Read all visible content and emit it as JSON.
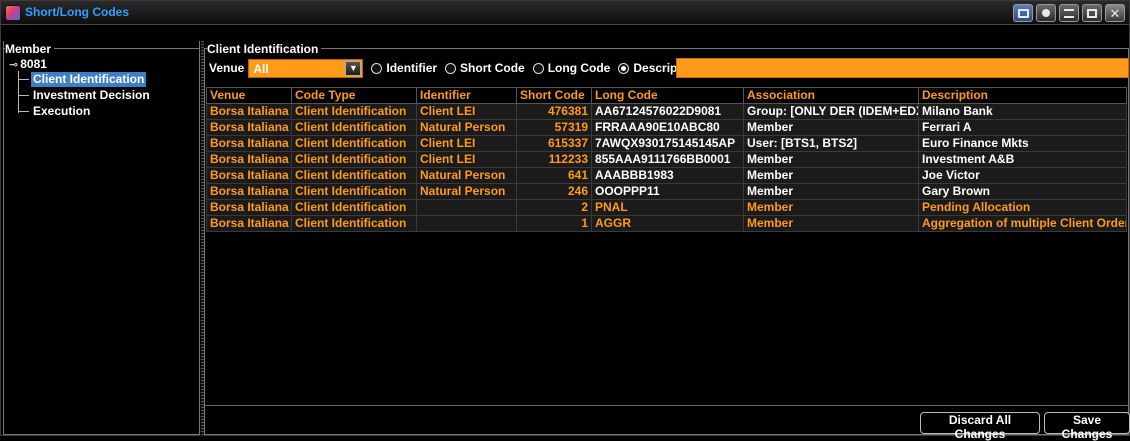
{
  "window": {
    "title": "Short/Long Codes"
  },
  "tree": {
    "legend": "Member",
    "root": "8081",
    "items": [
      {
        "label": "Client Identification",
        "selected": true
      },
      {
        "label": "Investment Decision",
        "selected": false
      },
      {
        "label": "Execution",
        "selected": false
      }
    ]
  },
  "group": {
    "legend": "Client Identification"
  },
  "filter": {
    "venue_label": "Venue",
    "venue_value": "All",
    "radios": [
      {
        "label": "Identifier",
        "checked": false
      },
      {
        "label": "Short Code",
        "checked": false
      },
      {
        "label": "Long Code",
        "checked": false
      },
      {
        "label": "Description",
        "checked": true
      }
    ],
    "search_value": ""
  },
  "table": {
    "columns": [
      "Venue",
      "Code Type",
      "Identifier",
      "Short Code",
      "Long Code",
      "Association",
      "Description"
    ],
    "rows": [
      [
        "Borsa Italiana",
        "Client Identification",
        "Client LEI",
        "476381",
        "AA67124576022D9081",
        "Group: [ONLY DER (IDEM+EDX)]",
        "Milano Bank"
      ],
      [
        "Borsa Italiana",
        "Client Identification",
        "Natural Person",
        "57319",
        "FRRAAA90E10ABC80",
        "Member",
        "Ferrari A"
      ],
      [
        "Borsa Italiana",
        "Client Identification",
        "Client LEI",
        "615337",
        "7AWQX930175145145AP",
        "User: [BTS1, BTS2]",
        "Euro Finance Mkts"
      ],
      [
        "Borsa Italiana",
        "Client Identification",
        "Client LEI",
        "112233",
        "855AAA9111766BB0001",
        "Member",
        "Investment A&B"
      ],
      [
        "Borsa Italiana",
        "Client Identification",
        "Natural Person",
        "641",
        "AAABBB1983",
        "Member",
        "Joe Victor"
      ],
      [
        "Borsa Italiana",
        "Client Identification",
        "Natural Person",
        "246",
        "OOOPPP11",
        "Member",
        "Gary Brown"
      ],
      [
        "Borsa Italiana",
        "Client Identification",
        "",
        "2",
        "PNAL",
        "Member",
        "Pending Allocation"
      ],
      [
        "Borsa Italiana",
        "Client Identification",
        "",
        "1",
        "AGGR",
        "Member",
        "Aggregation of multiple Client Order"
      ]
    ],
    "pending_rows": [
      6,
      7
    ]
  },
  "buttons": {
    "discard": "Discard All Changes",
    "save": "Save Changes"
  },
  "colors": {
    "accent": "#ff9a1a",
    "title": "#2fa0ff",
    "selection": "#3d7fc7"
  }
}
